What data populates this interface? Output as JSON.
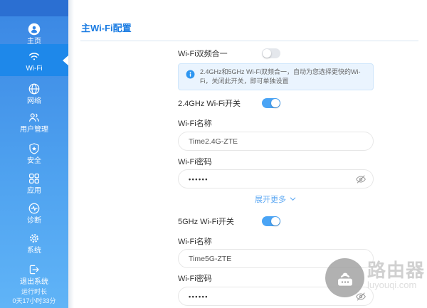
{
  "sidebar": {
    "items": [
      {
        "label": "主页",
        "icon": "home-user-icon"
      },
      {
        "label": "Wi-Fi",
        "icon": "wifi-icon",
        "active": true
      },
      {
        "label": "网络",
        "icon": "network-globe-icon"
      },
      {
        "label": "用户管理",
        "icon": "users-icon"
      },
      {
        "label": "安全",
        "icon": "security-shield-icon"
      },
      {
        "label": "应用",
        "icon": "apps-grid-icon"
      },
      {
        "label": "诊断",
        "icon": "diagnosis-pulse-icon"
      },
      {
        "label": "系统",
        "icon": "system-gear-icon"
      },
      {
        "label": "退出系统",
        "icon": "logout-icon"
      }
    ],
    "uptime_label": "运行时长",
    "uptime_value": "0天17小时33分"
  },
  "header": {
    "title": "主Wi-Fi配置"
  },
  "form": {
    "dual_band": {
      "label": "Wi-Fi双频合一",
      "enabled": false
    },
    "info_note": "2.4GHz和5GHz Wi-Fi双频合一，自动为您选择更快的Wi-Fi，关闭此开关，即可单独设置",
    "band_24g": {
      "switch_label": "2.4GHz Wi-Fi开关",
      "enabled": true,
      "name_label": "Wi-Fi名称",
      "name_value": "Time2.4G-ZTE",
      "password_label": "Wi-Fi密码",
      "password_value": "••••••"
    },
    "expand_more_label": "展开更多",
    "band_5g": {
      "switch_label": "5GHz Wi-Fi开关",
      "enabled": true,
      "name_label": "Wi-Fi名称",
      "name_value": "Time5G-ZTE",
      "password_label": "Wi-Fi密码",
      "password_value": "••••••"
    }
  },
  "watermark": {
    "title": "路由器",
    "subtitle": "luyouqi.com"
  },
  "colors": {
    "sidebar_top": "#3a86e3",
    "sidebar_bottom": "#60b4f7",
    "active_item": "#1e88ea",
    "title_blue": "#1b7ce2",
    "toggle_on": "#4aa4f5",
    "toggle_off": "#e4e7ec",
    "info_bg": "#eaf4fe",
    "link_blue": "#5ea9f3"
  }
}
